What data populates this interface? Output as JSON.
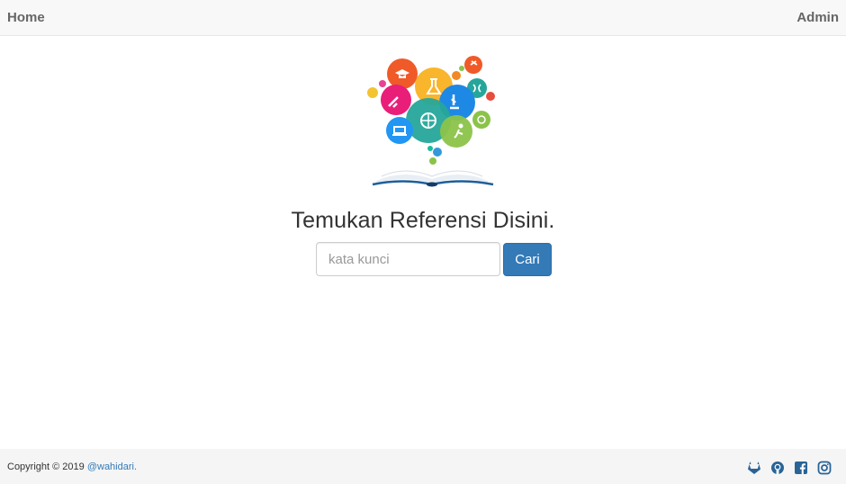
{
  "navbar": {
    "home_label": "Home",
    "admin_label": "Admin"
  },
  "hero": {
    "logo_icon": "book-science-logo-icon",
    "headline": "Temukan Referensi Disini.",
    "search": {
      "placeholder": "kata kunci",
      "value": "",
      "button_label": "Cari"
    }
  },
  "footer": {
    "copyright_text": "Copyright © 2019",
    "author_link": "@wahidari.",
    "social_icons": [
      "gitlab-icon",
      "github-icon",
      "facebook-icon",
      "instagram-icon"
    ]
  },
  "colors": {
    "primary_button": "#337ab7",
    "link": "#337ab7",
    "navbar_bg": "#f8f8f8",
    "footer_bg": "#f5f5f5",
    "social_icon": "#2a6496"
  }
}
